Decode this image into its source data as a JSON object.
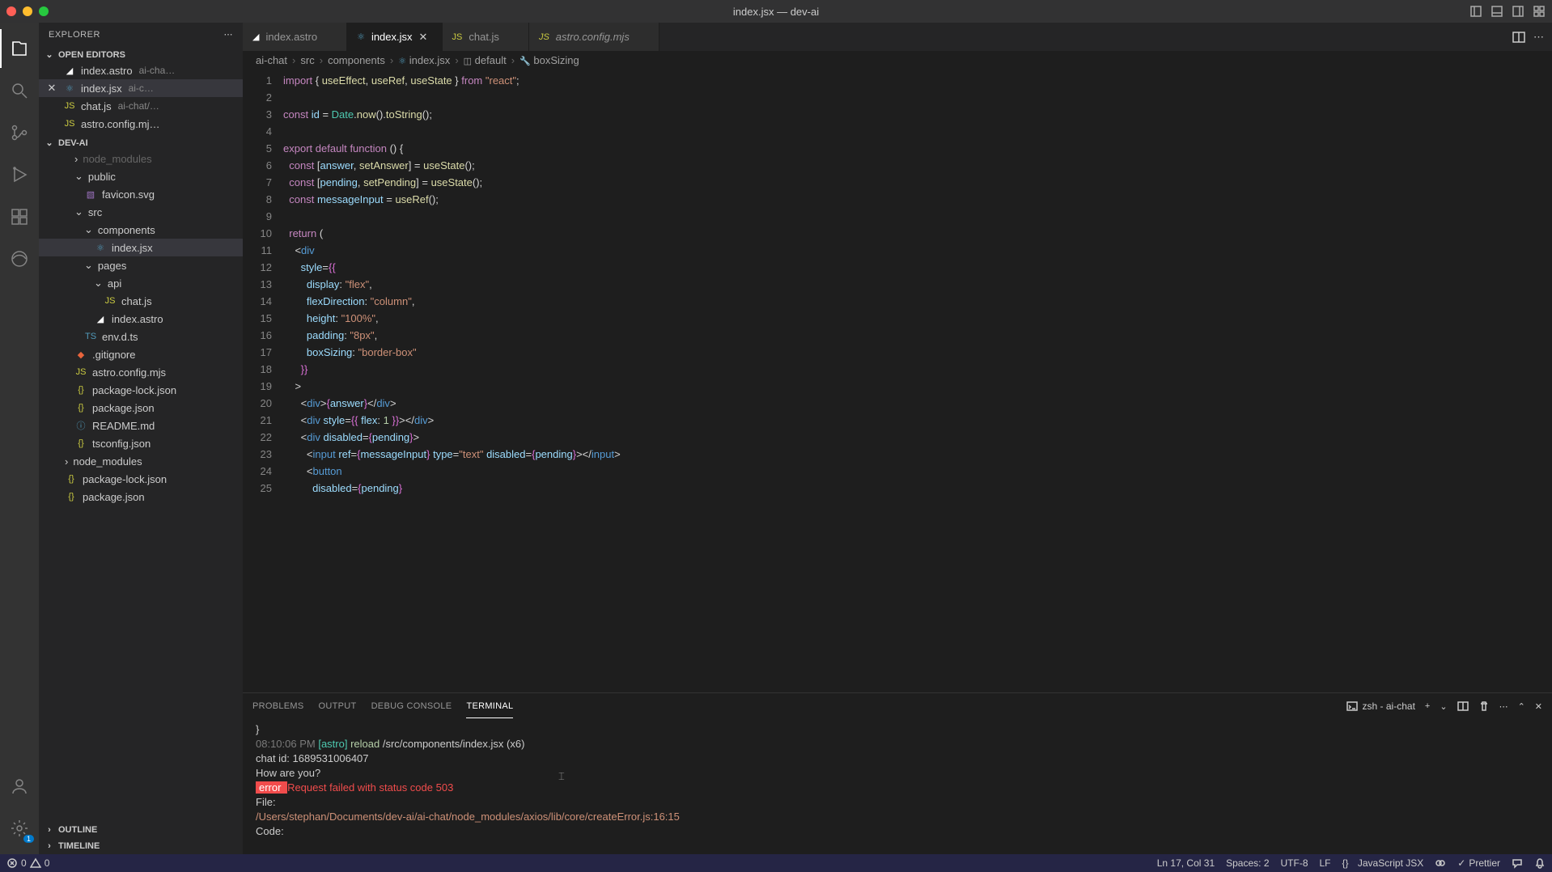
{
  "window": {
    "title": "index.jsx — dev-ai"
  },
  "sidebar": {
    "title": "EXPLORER",
    "sections": {
      "openEditors": {
        "label": "OPEN EDITORS",
        "items": [
          {
            "name": "index.astro",
            "desc": "ai-cha…",
            "icon": "astro"
          },
          {
            "name": "index.jsx",
            "desc": "ai-c…",
            "icon": "react",
            "active": true
          },
          {
            "name": "chat.js",
            "desc": "ai-chat/…",
            "icon": "js"
          },
          {
            "name": "astro.config.mj…",
            "desc": "",
            "icon": "js"
          }
        ]
      },
      "folder": {
        "label": "DEV-AI",
        "tree": [
          {
            "name": "node_modules",
            "kind": "folder",
            "depth": 0,
            "dim": true
          },
          {
            "name": "public",
            "kind": "folder",
            "depth": 0,
            "open": true
          },
          {
            "name": "favicon.svg",
            "kind": "file",
            "depth": 1,
            "icon": "svg"
          },
          {
            "name": "src",
            "kind": "folder",
            "depth": 0,
            "open": true
          },
          {
            "name": "components",
            "kind": "folder",
            "depth": 1,
            "open": true
          },
          {
            "name": "index.jsx",
            "kind": "file",
            "depth": 2,
            "icon": "react",
            "selected": true
          },
          {
            "name": "pages",
            "kind": "folder",
            "depth": 1,
            "open": true
          },
          {
            "name": "api",
            "kind": "folder",
            "depth": 2,
            "open": true
          },
          {
            "name": "chat.js",
            "kind": "file",
            "depth": 3,
            "icon": "js"
          },
          {
            "name": "index.astro",
            "kind": "file",
            "depth": 2,
            "icon": "astro"
          },
          {
            "name": "env.d.ts",
            "kind": "file",
            "depth": 1,
            "icon": "ts"
          },
          {
            "name": ".gitignore",
            "kind": "file",
            "depth": 0,
            "icon": "git"
          },
          {
            "name": "astro.config.mjs",
            "kind": "file",
            "depth": 0,
            "icon": "js"
          },
          {
            "name": "package-lock.json",
            "kind": "file",
            "depth": 0,
            "icon": "json"
          },
          {
            "name": "package.json",
            "kind": "file",
            "depth": 0,
            "icon": "json"
          },
          {
            "name": "README.md",
            "kind": "file",
            "depth": 0,
            "icon": "info"
          },
          {
            "name": "tsconfig.json",
            "kind": "file",
            "depth": 0,
            "icon": "json"
          },
          {
            "name": "node_modules",
            "kind": "folder",
            "depth": -1
          },
          {
            "name": "package-lock.json",
            "kind": "file",
            "depth": -1,
            "icon": "json"
          },
          {
            "name": "package.json",
            "kind": "file",
            "depth": -1,
            "icon": "json"
          }
        ]
      },
      "outline": {
        "label": "OUTLINE"
      },
      "timeline": {
        "label": "TIMELINE"
      }
    }
  },
  "tabs": [
    {
      "name": "index.astro",
      "icon": "astro"
    },
    {
      "name": "index.jsx",
      "icon": "react",
      "active": true,
      "close": true
    },
    {
      "name": "chat.js",
      "icon": "js"
    },
    {
      "name": "astro.config.mjs",
      "icon": "js",
      "italic": true
    }
  ],
  "breadcrumbs": [
    {
      "label": "ai-chat"
    },
    {
      "label": "src"
    },
    {
      "label": "components"
    },
    {
      "label": "index.jsx",
      "icon": "react"
    },
    {
      "label": "default",
      "icon": "cube"
    },
    {
      "label": "boxSizing",
      "icon": "wrench"
    }
  ],
  "code": {
    "lines": [
      [
        [
          "kw",
          "import"
        ],
        [
          "pn",
          " { "
        ],
        [
          "fn",
          "useEffect"
        ],
        [
          "pn",
          ", "
        ],
        [
          "fn",
          "useRef"
        ],
        [
          "pn",
          ", "
        ],
        [
          "fn",
          "useState"
        ],
        [
          "pn",
          " } "
        ],
        [
          "kw",
          "from"
        ],
        [
          "pn",
          " "
        ],
        [
          "str",
          "\"react\""
        ],
        [
          "pn",
          ";"
        ]
      ],
      [],
      [
        [
          "kw",
          "const"
        ],
        [
          "pn",
          " "
        ],
        [
          "var",
          "id"
        ],
        [
          "pn",
          " = "
        ],
        [
          "typ",
          "Date"
        ],
        [
          "pn",
          "."
        ],
        [
          "fn",
          "now"
        ],
        [
          "pn",
          "()."
        ],
        [
          "fn",
          "toString"
        ],
        [
          "pn",
          "();"
        ]
      ],
      [],
      [
        [
          "kw",
          "export"
        ],
        [
          "pn",
          " "
        ],
        [
          "kw",
          "default"
        ],
        [
          "pn",
          " "
        ],
        [
          "kw",
          "function"
        ],
        [
          "pn",
          " () {"
        ]
      ],
      [
        [
          "pn",
          "  "
        ],
        [
          "kw",
          "const"
        ],
        [
          "pn",
          " ["
        ],
        [
          "var",
          "answer"
        ],
        [
          "pn",
          ", "
        ],
        [
          "fn",
          "setAnswer"
        ],
        [
          "pn",
          "] = "
        ],
        [
          "fn",
          "useState"
        ],
        [
          "pn",
          "();"
        ]
      ],
      [
        [
          "pn",
          "  "
        ],
        [
          "kw",
          "const"
        ],
        [
          "pn",
          " ["
        ],
        [
          "var",
          "pending"
        ],
        [
          "pn",
          ", "
        ],
        [
          "fn",
          "setPending"
        ],
        [
          "pn",
          "] = "
        ],
        [
          "fn",
          "useState"
        ],
        [
          "pn",
          "();"
        ]
      ],
      [
        [
          "pn",
          "  "
        ],
        [
          "kw",
          "const"
        ],
        [
          "pn",
          " "
        ],
        [
          "var",
          "messageInput"
        ],
        [
          "pn",
          " = "
        ],
        [
          "fn",
          "useRef"
        ],
        [
          "pn",
          "();"
        ]
      ],
      [],
      [
        [
          "pn",
          "  "
        ],
        [
          "kw",
          "return"
        ],
        [
          "pn",
          " ("
        ]
      ],
      [
        [
          "pn",
          "    <"
        ],
        [
          "tag",
          "div"
        ]
      ],
      [
        [
          "pn",
          "      "
        ],
        [
          "attr",
          "style"
        ],
        [
          "pn",
          "="
        ],
        [
          "brace",
          "{{"
        ]
      ],
      [
        [
          "pn",
          "        "
        ],
        [
          "var",
          "display"
        ],
        [
          "pn",
          ": "
        ],
        [
          "str",
          "\"flex\""
        ],
        [
          "pn",
          ","
        ]
      ],
      [
        [
          "pn",
          "        "
        ],
        [
          "var",
          "flexDirection"
        ],
        [
          "pn",
          ": "
        ],
        [
          "str",
          "\"column\""
        ],
        [
          "pn",
          ","
        ]
      ],
      [
        [
          "pn",
          "        "
        ],
        [
          "var",
          "height"
        ],
        [
          "pn",
          ": "
        ],
        [
          "str",
          "\"100%\""
        ],
        [
          "pn",
          ","
        ]
      ],
      [
        [
          "pn",
          "        "
        ],
        [
          "var",
          "padding"
        ],
        [
          "pn",
          ": "
        ],
        [
          "str",
          "\"8px\""
        ],
        [
          "pn",
          ","
        ]
      ],
      [
        [
          "pn",
          "        "
        ],
        [
          "var",
          "boxSizing"
        ],
        [
          "pn",
          ": "
        ],
        [
          "str",
          "\"border-box\""
        ]
      ],
      [
        [
          "pn",
          "      "
        ],
        [
          "brace",
          "}}"
        ]
      ],
      [
        [
          "pn",
          "    >"
        ]
      ],
      [
        [
          "pn",
          "      <"
        ],
        [
          "tag",
          "div"
        ],
        [
          "pn",
          ">"
        ],
        [
          "brace",
          "{"
        ],
        [
          "var",
          "answer"
        ],
        [
          "brace",
          "}"
        ],
        [
          "pn",
          "</"
        ],
        [
          "tag",
          "div"
        ],
        [
          "pn",
          ">"
        ]
      ],
      [
        [
          "pn",
          "      <"
        ],
        [
          "tag",
          "div"
        ],
        [
          "pn",
          " "
        ],
        [
          "attr",
          "style"
        ],
        [
          "pn",
          "="
        ],
        [
          "brace",
          "{{"
        ],
        [
          "pn",
          " "
        ],
        [
          "var",
          "flex"
        ],
        [
          "pn",
          ": "
        ],
        [
          "num",
          "1"
        ],
        [
          "pn",
          " "
        ],
        [
          "brace",
          "}}"
        ],
        [
          "pn",
          "></"
        ],
        [
          "tag",
          "div"
        ],
        [
          "pn",
          ">"
        ]
      ],
      [
        [
          "pn",
          "      <"
        ],
        [
          "tag",
          "div"
        ],
        [
          "pn",
          " "
        ],
        [
          "attr",
          "disabled"
        ],
        [
          "pn",
          "="
        ],
        [
          "brace",
          "{"
        ],
        [
          "var",
          "pending"
        ],
        [
          "brace",
          "}"
        ],
        [
          "pn",
          ">"
        ]
      ],
      [
        [
          "pn",
          "        <"
        ],
        [
          "tag",
          "input"
        ],
        [
          "pn",
          " "
        ],
        [
          "attr",
          "ref"
        ],
        [
          "pn",
          "="
        ],
        [
          "brace",
          "{"
        ],
        [
          "var",
          "messageInput"
        ],
        [
          "brace",
          "}"
        ],
        [
          "pn",
          " "
        ],
        [
          "attr",
          "type"
        ],
        [
          "pn",
          "="
        ],
        [
          "str",
          "\"text\""
        ],
        [
          "pn",
          " "
        ],
        [
          "attr",
          "disabled"
        ],
        [
          "pn",
          "="
        ],
        [
          "brace",
          "{"
        ],
        [
          "var",
          "pending"
        ],
        [
          "brace",
          "}"
        ],
        [
          "pn",
          "></"
        ],
        [
          "tag",
          "input"
        ],
        [
          "pn",
          ">"
        ]
      ],
      [
        [
          "pn",
          "        <"
        ],
        [
          "tag",
          "button"
        ]
      ],
      [
        [
          "pn",
          "          "
        ],
        [
          "attr",
          "disabled"
        ],
        [
          "pn",
          "="
        ],
        [
          "brace",
          "{"
        ],
        [
          "var",
          "pending"
        ],
        [
          "brace",
          "}"
        ]
      ]
    ]
  },
  "panel": {
    "tabs": [
      "PROBLEMS",
      "OUTPUT",
      "DEBUG CONSOLE",
      "TERMINAL"
    ],
    "active": 3,
    "shell": "zsh - ai-chat"
  },
  "terminal": {
    "lines": [
      {
        "parts": [
          [
            "pn",
            "  }"
          ]
        ]
      },
      {
        "parts": [
          [
            "dim",
            "08:10:06 PM "
          ],
          [
            "astro",
            "[astro]"
          ],
          [
            "pn",
            " "
          ],
          [
            "reload",
            "reload"
          ],
          [
            "pn",
            " /src/components/index.jsx (x6)"
          ]
        ]
      },
      {
        "parts": [
          [
            "pn",
            "chat id: 1689531006407"
          ]
        ]
      },
      {
        "parts": [
          [
            "pn",
            "How are you?"
          ]
        ]
      },
      {
        "parts": [
          [
            "errb",
            " error "
          ],
          [
            "pn",
            "   "
          ],
          [
            "errt",
            "Request failed with status code 503"
          ]
        ]
      },
      {
        "parts": [
          [
            "pn",
            "  "
          ],
          [
            "pn",
            "File:"
          ]
        ]
      },
      {
        "parts": [
          [
            "pn",
            "    "
          ],
          [
            "path",
            "/Users/stephan/Documents/dev-ai/ai-chat/node_modules/axios/lib/core/createError.js:16:15"
          ]
        ]
      },
      {
        "parts": [
          [
            "pn",
            "  Code:"
          ]
        ]
      }
    ]
  },
  "statusbar": {
    "errors": "0",
    "warnings": "0",
    "position": "Ln 17, Col 31",
    "spaces": "Spaces: 2",
    "encoding": "UTF-8",
    "eol": "LF",
    "lang": "JavaScript JSX",
    "prettier": "Prettier"
  },
  "scm_badge": "1"
}
